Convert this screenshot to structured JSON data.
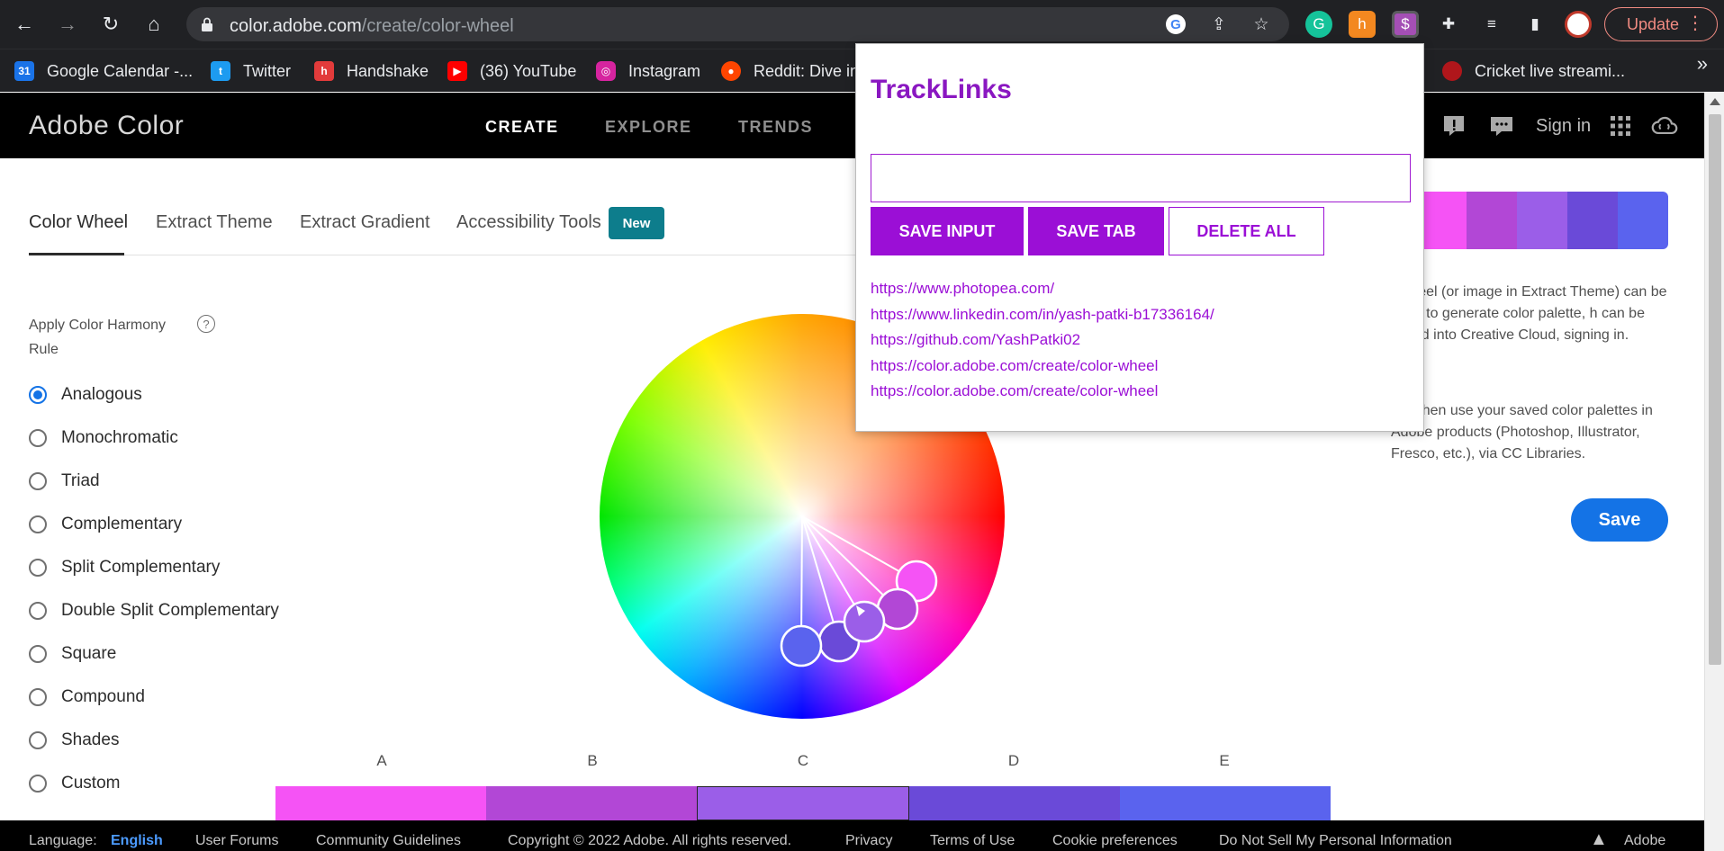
{
  "browser": {
    "url_host": "color.adobe.com",
    "url_path": "/create/color-wheel",
    "update_label": "Update",
    "bookmarks": [
      {
        "label": "Google Calendar -...",
        "icon": "calendar-icon",
        "color": "#1a73e8"
      },
      {
        "label": "Twitter",
        "icon": "twitter-icon",
        "color": "#1d9bf0"
      },
      {
        "label": "Handshake",
        "icon": "handshake-icon",
        "color": "#e23b3b"
      },
      {
        "label": "(36) YouTube",
        "icon": "youtube-icon",
        "color": "#ff0000"
      },
      {
        "label": "Instagram",
        "icon": "instagram-icon",
        "color": "#d6249f"
      },
      {
        "label": "Reddit: Dive in",
        "icon": "reddit-icon",
        "color": "#ff4500"
      },
      {
        "label": "Cricket live streami...",
        "icon": "cricket-icon",
        "color": "#b0161b"
      }
    ]
  },
  "header": {
    "logo": "Adobe Color",
    "nav": [
      "CREATE",
      "EXPLORE",
      "TRENDS"
    ],
    "sign_in": "Sign in"
  },
  "tabs": {
    "items": [
      "Color Wheel",
      "Extract Theme",
      "Extract Gradient",
      "Accessibility Tools"
    ],
    "badge": "New"
  },
  "harmony": {
    "title": "Apply Color Harmony Rule",
    "help": "?",
    "rules": [
      "Analogous",
      "Monochromatic",
      "Triad",
      "Complementary",
      "Split Complementary",
      "Double Split Complementary",
      "Square",
      "Compound",
      "Shades",
      "Custom"
    ],
    "selected": "Analogous"
  },
  "swatches": {
    "labels": [
      "A",
      "B",
      "C",
      "D",
      "E"
    ],
    "colors": [
      "#f553f5",
      "#b247d6",
      "#9b5ee8",
      "#6a4ad8",
      "#5a63ee"
    ],
    "selected_index": 2
  },
  "right_panel": {
    "strip_colors": [
      "#f553f5",
      "#b247d6",
      "#9b5ee8",
      "#6a4ad8",
      "#5a63ee"
    ],
    "text1": "r wheel (or image in Extract Theme) can be used to generate color palette, h can be saved into Creative Cloud, signing in.",
    "text2": "can then use your saved color palettes in Adobe products (Photoshop, Illustrator, Fresco, etc.), via CC Libraries.",
    "save_label": "Save"
  },
  "footer": {
    "language_label": "Language:",
    "language_value": "English",
    "links": [
      "User Forums",
      "Community Guidelines",
      "Copyright © 2022 Adobe. All rights reserved.",
      "Privacy",
      "Terms of Use",
      "Cookie preferences",
      "Do Not Sell My Personal Information"
    ],
    "brand": "Adobe"
  },
  "popup": {
    "title": "TrackLinks",
    "input_value": "",
    "buttons": [
      "SAVE INPUT",
      "SAVE TAB",
      "DELETE ALL"
    ],
    "links": [
      "https://www.photopea.com/",
      "https://www.linkedin.com/in/yash-patki-b17336164/",
      "https://github.com/YashPatki02",
      "https://color.adobe.com/create/color-wheel",
      "https://color.adobe.com/create/color-wheel"
    ]
  },
  "colors": {
    "accent": "#1473e6",
    "popup_accent": "#9b0fd6",
    "badge": "#0d7d8c"
  }
}
